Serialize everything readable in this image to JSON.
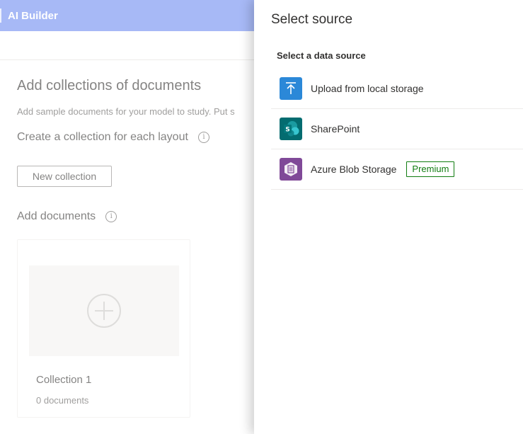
{
  "app": {
    "title": "AI Builder",
    "heading": "Add collections of documents",
    "description": "Add sample documents for your model to study. Put s",
    "collection_heading": "Create a collection for each layout",
    "new_collection_label": "New collection",
    "documents_heading": "Add documents",
    "collection": {
      "title": "Collection 1",
      "count": "0 documents"
    }
  },
  "panel": {
    "title": "Select source",
    "subtitle": "Select a data source",
    "sources": [
      {
        "label": "Upload from local storage",
        "icon": "upload-icon",
        "color": "#2b88d8"
      },
      {
        "label": "SharePoint",
        "icon": "sharepoint-icon",
        "color": "#036c70"
      },
      {
        "label": "Azure Blob Storage",
        "icon": "azure-blob-storage-icon",
        "color": "#804998",
        "badge": "Premium"
      }
    ]
  },
  "colors": {
    "topbar": "#6d8bf0",
    "premium": "#107c10"
  }
}
